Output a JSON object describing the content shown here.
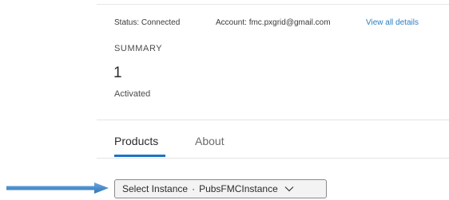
{
  "status": {
    "status_text": "Status: Connected",
    "account_text": "Account: fmc.pxgrid@gmail.com",
    "view_details_link": "View all details"
  },
  "summary": {
    "heading": "SUMMARY",
    "count": "1",
    "count_label": "Activated"
  },
  "tabs": [
    {
      "label": "Products",
      "active": true
    },
    {
      "label": "About",
      "active": false
    }
  ],
  "instance_selector": {
    "prefix": "Select Instance",
    "separator": "·",
    "value": "PubsFMCInstance",
    "icon": "chevron-down-icon"
  },
  "annotation": {
    "icon": "pointer-arrow-icon",
    "color": "#4a8fcf"
  },
  "colors": {
    "accent": "#1f73c4",
    "link": "#2a7ec4"
  }
}
